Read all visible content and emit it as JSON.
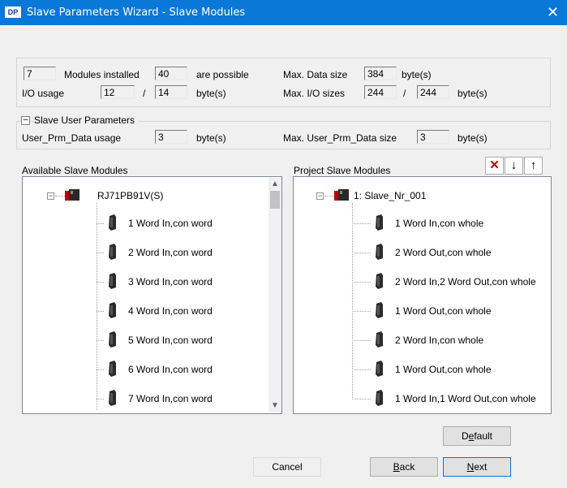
{
  "window": {
    "title": "Slave Parameters Wizard - Slave Modules",
    "icon": "DP",
    "close_glyph": "✕"
  },
  "summary": {
    "modules_installed_value": "7",
    "modules_installed_label": "Modules installed",
    "possible_value": "40",
    "possible_label": "are possible",
    "max_data_size_label": "Max. Data size",
    "max_data_size_value": "384",
    "max_data_size_unit": "byte(s)",
    "io_usage_label": "I/O usage",
    "io_usage_value1": "12",
    "io_usage_sep": "/",
    "io_usage_value2": "14",
    "io_usage_unit": "byte(s)",
    "max_io_label": "Max. I/O sizes",
    "max_io_value1": "244",
    "max_io_sep": "/",
    "max_io_value2": "244",
    "max_io_unit": "byte(s)"
  },
  "user_params": {
    "collapse_glyph": "−",
    "section_label": "Slave User Parameters",
    "usage_label": "User_Prm_Data usage",
    "usage_value": "3",
    "usage_unit": "byte(s)",
    "max_label": "Max. User_Prm_Data size",
    "max_value": "3",
    "max_unit": "byte(s)"
  },
  "available": {
    "header": "Available Slave Modules",
    "root": "RJ71PB91V(S)",
    "items": [
      "1 Word In,con word",
      "2 Word In,con word",
      "3 Word In,con word",
      "4 Word In,con word",
      "5 Word In,con word",
      "6 Word In,con word",
      "7 Word In,con word"
    ]
  },
  "project": {
    "header": "Project Slave Modules",
    "root": "1: Slave_Nr_001",
    "items": [
      "1 Word In,con whole",
      "2 Word Out,con whole",
      "2 Word In,2 Word Out,con whole",
      "1 Word Out,con whole",
      "2 Word In,con whole",
      "1 Word Out,con whole",
      "1 Word In,1 Word Out,con whole"
    ]
  },
  "toolbar": {
    "delete_glyph": "✕",
    "down_glyph": "↓",
    "up_glyph": "↑"
  },
  "buttons": {
    "default_pre": "D",
    "default_ul": "e",
    "default_post": "fault",
    "cancel": "Cancel",
    "back_ul": "B",
    "back_post": "ack",
    "next_ul": "N",
    "next_post": "ext"
  },
  "colors": {
    "titlebar": "#0a78d7",
    "accent": "#0078d7",
    "window_bg": "#f0f0f0"
  }
}
